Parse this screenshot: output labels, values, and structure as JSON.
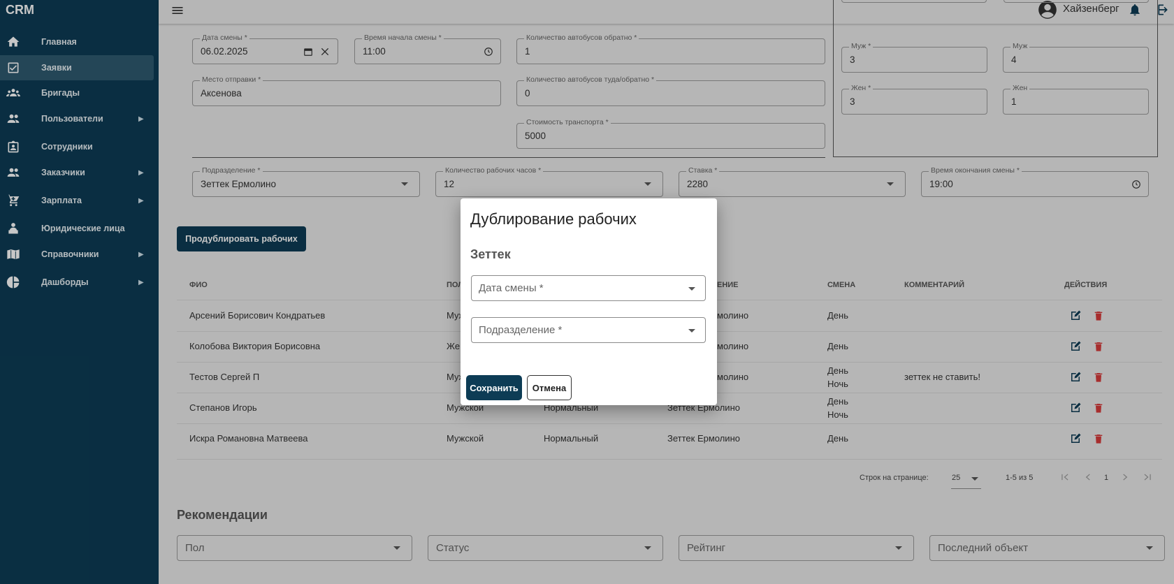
{
  "app": {
    "brand": "CRM"
  },
  "sidebar": {
    "items": [
      {
        "label": "Главная",
        "icon": "home-icon",
        "has_submenu": false
      },
      {
        "label": "Заявки",
        "icon": "checklist-icon",
        "has_submenu": false,
        "active": true
      },
      {
        "label": "Бригады",
        "icon": "groups-icon",
        "has_submenu": false
      },
      {
        "label": "Пользователи",
        "icon": "people-icon",
        "has_submenu": true
      },
      {
        "label": "Сотрудники",
        "icon": "badge-icon",
        "has_submenu": false
      },
      {
        "label": "Заказчики",
        "icon": "people-icon",
        "has_submenu": true
      },
      {
        "label": "Зарплата",
        "icon": "cart-icon",
        "has_submenu": true
      },
      {
        "label": "Юридические лица",
        "icon": "person-desk-icon",
        "has_submenu": false
      },
      {
        "label": "Справочники",
        "icon": "book-icon",
        "has_submenu": true
      },
      {
        "label": "Дашборды",
        "icon": "pie-chart-icon",
        "has_submenu": true
      }
    ]
  },
  "topbar": {
    "user_name": "Хайзенберг"
  },
  "form": {
    "shift_date": {
      "label": "Дата смены *",
      "value": "06.02.2025"
    },
    "shift_start": {
      "label": "Время начала смены *",
      "value": "11:00"
    },
    "buses_back": {
      "label": "Количество автобусов обратно *",
      "value": "1"
    },
    "departure": {
      "label": "Место отправки *",
      "value": "Аксенова"
    },
    "buses_roundtrip": {
      "label": "Количество автобусов туда/обратно *",
      "value": "0"
    },
    "transport_cost": {
      "label": "Стоимость транспорта *",
      "value": "5000"
    },
    "male_required": {
      "label": "Муж *",
      "value": "3"
    },
    "male_actual": {
      "label": "Муж",
      "value": "4"
    },
    "female_required": {
      "label": "Жен *",
      "value": "3"
    },
    "female_actual": {
      "label": "Жен",
      "value": "1"
    },
    "division": {
      "label": "Подразделение *",
      "value": "Зеттек Ермолино"
    },
    "work_hours": {
      "label": "Количество рабочих часов *",
      "value": "12"
    },
    "rate": {
      "label": "Ставка *",
      "value": "2280"
    },
    "shift_end": {
      "label": "Время окончания смены *",
      "value": "19:00"
    }
  },
  "duplicate_button": "Продублировать рабочих",
  "table": {
    "headers": {
      "fio": "ФИО",
      "gender": "ПОЛ",
      "division": "ЕНИЕ",
      "shift": "СМЕНА",
      "comment": "КОММЕНТАРИЙ",
      "actions": "ДЕЙСТВИЯ"
    },
    "rows": [
      {
        "fio": "Арсений Борисович Кондратьев",
        "gender": "Муж",
        "status": "",
        "division": "молино",
        "shift1": "День",
        "shift2": "",
        "comment": ""
      },
      {
        "fio": "Колобова Виктория Борисовна",
        "gender": "Жен",
        "status": "",
        "division": "молино",
        "shift1": "День",
        "shift2": "",
        "comment": ""
      },
      {
        "fio": "Тестов Сергей П",
        "gender": "Муж",
        "status": "",
        "division": "молино",
        "shift1": "День",
        "shift2": "Ночь",
        "comment": "зеттек не ставить!"
      },
      {
        "fio": "Степанов Игорь",
        "gender": "Мужской",
        "status": "Нормальный",
        "division": "Зеттек Ермолино",
        "shift1": "День",
        "shift2": "Ночь",
        "comment": ""
      },
      {
        "fio": "Искра Романовна Матвеева",
        "gender": "Мужской",
        "status": "Нормальный",
        "division": "Зеттек Ермолино",
        "shift1": "День",
        "shift2": "",
        "comment": ""
      }
    ]
  },
  "pagination": {
    "rows_per_page_label": "Строк на странице:",
    "rows_per_page": "25",
    "range": "1-5 из 5",
    "page": "1"
  },
  "recommendations": {
    "title": "Рекомендации",
    "filters": [
      "Пол",
      "Статус",
      "Рейтинг",
      "Последний объект"
    ]
  },
  "dialog": {
    "title": "Дублирование рабочих",
    "subtitle": "Зеттек",
    "date_placeholder": "Дата смены *",
    "division_placeholder": "Подразделение *",
    "save": "Сохранить",
    "cancel": "Отмена"
  },
  "colors": {
    "primary": "#0d3c55",
    "sidebar_active": "#2f5a70",
    "edit": "#0d3c55",
    "delete": "#d63a3a"
  }
}
